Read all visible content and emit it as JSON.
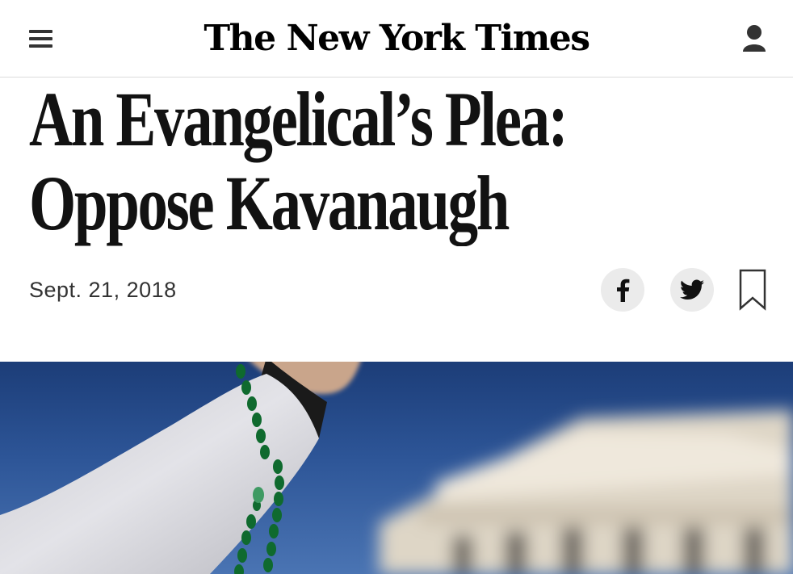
{
  "header": {
    "logo_text": "The New York Times",
    "menu_icon": "hamburger-menu-icon",
    "account_icon": "user-icon"
  },
  "article": {
    "headline_line1": "An Evangelical’s Plea:",
    "headline_line2": "Oppose Kavanaugh",
    "date": "Sept. 21, 2018"
  },
  "share": {
    "facebook_icon": "facebook-icon",
    "twitter_icon": "twitter-icon",
    "bookmark_icon": "bookmark-icon"
  },
  "colors": {
    "text": "#121212",
    "share_bg": "#ebebeb",
    "sky": "#2d5597"
  }
}
